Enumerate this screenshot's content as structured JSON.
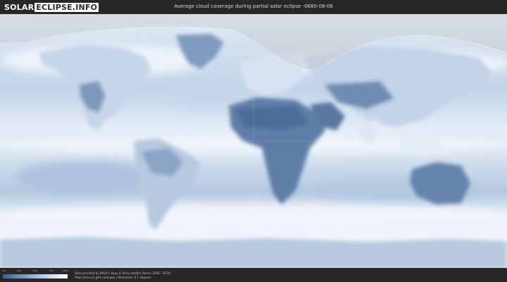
{
  "header": {
    "logo_part1": "SOLAR",
    "logo_part2": "ECLIPSE.INFO",
    "title": "Average cloud coverage during partial solar eclipse -0680-08-06"
  },
  "legend": {
    "ticks": [
      "0%",
      "25%",
      "50%",
      "75%",
      "100%"
    ],
    "colors": {
      "clear": "#3f5f8a",
      "cloudy": "#ffffff"
    }
  },
  "credit": {
    "line1": "Data provided by NASA's Aqua & Terra satellite (Years: 2000 - 2019)",
    "line2": "https://neo.sci.gsfc.nasa.gov | Resolution: 0.1 degrees"
  },
  "map": {
    "colors": {
      "cloud": "#eef3f9",
      "clear_land": "#5d7ba3",
      "ocean_mid": "#b9cce3",
      "eclipse_overlay": "#c9cdd3"
    }
  }
}
